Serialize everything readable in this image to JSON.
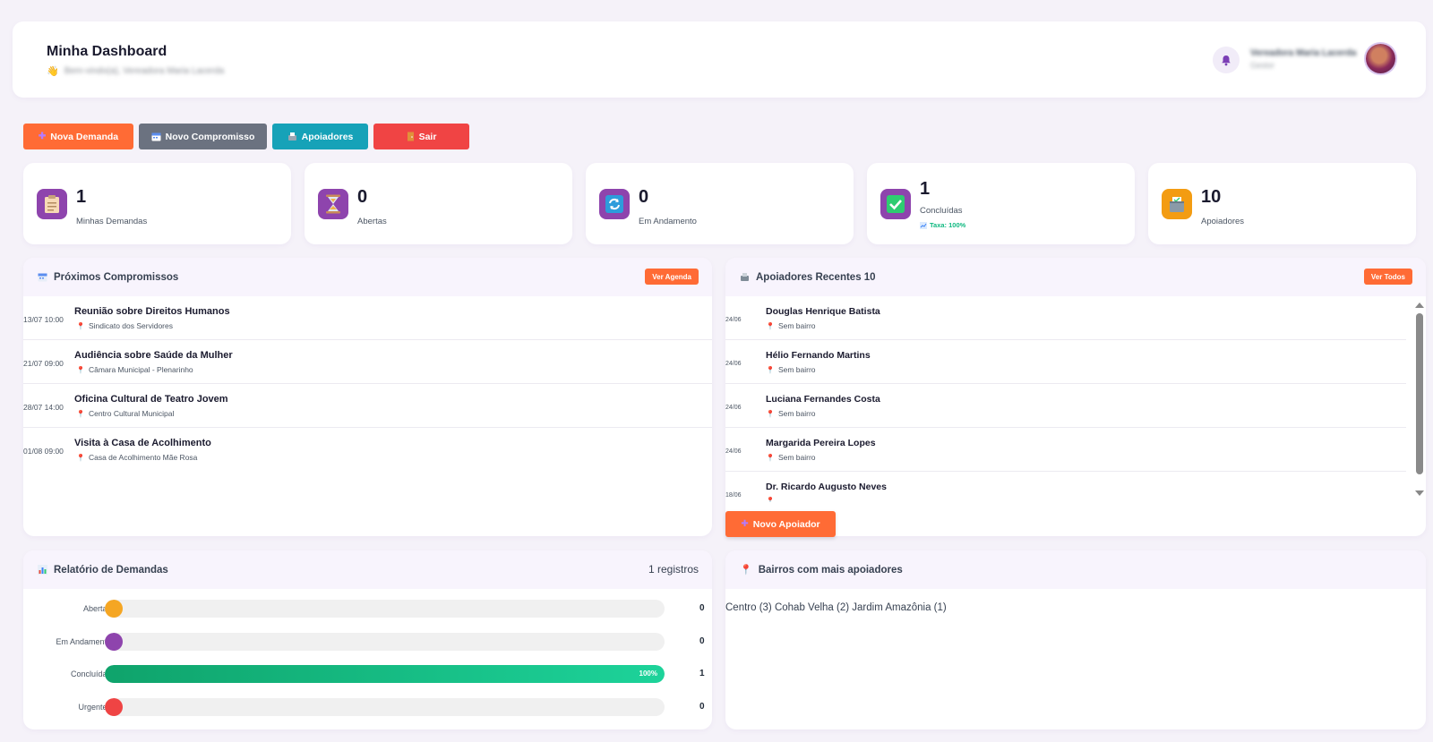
{
  "header": {
    "title": "Minha Dashboard",
    "greeting": "Bem-vindo(a), Vereadora Maria Lacerda",
    "user_name": "Vereadora Maria Lacerda",
    "user_role": "Gestor",
    "icons": {
      "wave": "hand-wave-icon",
      "bell": "bell-icon"
    }
  },
  "actions": {
    "nova_demanda": "Nova Demanda",
    "novo_compromisso": "Novo Compromisso",
    "apoiadores": "Apoiadores",
    "sair": "Sair"
  },
  "stats": [
    {
      "value": "1",
      "label": "Minhas Demandas",
      "icon": "clipboard-icon",
      "color": "#8e44ad"
    },
    {
      "value": "0",
      "label": "Abertas",
      "icon": "hourglass-icon",
      "color": "#8e44ad"
    },
    {
      "value": "0",
      "label": "Em Andamento",
      "icon": "refresh-icon",
      "color": "#8e44ad"
    },
    {
      "value": "1",
      "label": "Concluídas",
      "icon": "check-icon",
      "color": "#8e44ad",
      "extra": "Taxa: 100%"
    },
    {
      "value": "10",
      "label": "Apoiadores",
      "icon": "ballot-box-icon",
      "color": "#f39c12"
    }
  ],
  "agenda": {
    "title": "Próximos Compromissos",
    "button": "Ver Agenda",
    "items": [
      {
        "date": "13/07 10:00",
        "title": "Reunião sobre Direitos Humanos",
        "location": "Sindicato dos Servidores"
      },
      {
        "date": "21/07 09:00",
        "title": "Audiência sobre Saúde da Mulher",
        "location": "Câmara Municipal - Plenarinho"
      },
      {
        "date": "28/07 14:00",
        "title": "Oficina Cultural de Teatro Jovem",
        "location": "Centro Cultural Municipal"
      },
      {
        "date": "01/08 09:00",
        "title": "Visita à Casa de Acolhimento",
        "location": "Casa de Acolhimento Mãe Rosa"
      }
    ]
  },
  "apoiadores": {
    "title": "Apoiadores Recentes 10",
    "button": "Ver Todos",
    "new_button": "Novo Apoiador",
    "items": [
      {
        "date": "24/06",
        "name": "Douglas Henrique Batista",
        "bairro": "Sem bairro"
      },
      {
        "date": "24/06",
        "name": "Hélio Fernando Martins",
        "bairro": "Sem bairro"
      },
      {
        "date": "24/06",
        "name": "Luciana Fernandes Costa",
        "bairro": "Sem bairro"
      },
      {
        "date": "24/06",
        "name": "Margarida Pereira Lopes",
        "bairro": "Sem bairro"
      },
      {
        "date": "18/06",
        "name": "Dr. Ricardo Augusto Neves",
        "bairro": ""
      }
    ]
  },
  "relatorio": {
    "title": "Relatório de Demandas",
    "count": "1 registros",
    "rows": [
      {
        "label": "Abertas",
        "value": "0",
        "fraction": 0,
        "color": "#f5a623"
      },
      {
        "label": "Em Andamento",
        "value": "0",
        "fraction": 0,
        "color": "#8e44ad"
      },
      {
        "label": "Concluídas",
        "value": "1",
        "fraction": 1,
        "pct": "100%",
        "color": "#10b981"
      },
      {
        "label": "Urgentes",
        "value": "0",
        "fraction": 0,
        "color": "#ef4444"
      }
    ]
  },
  "bairros": {
    "title": "Bairros com mais apoiadores",
    "text": "Centro (3) Cohab Velha (2) Jardim Amazônia (1)"
  }
}
